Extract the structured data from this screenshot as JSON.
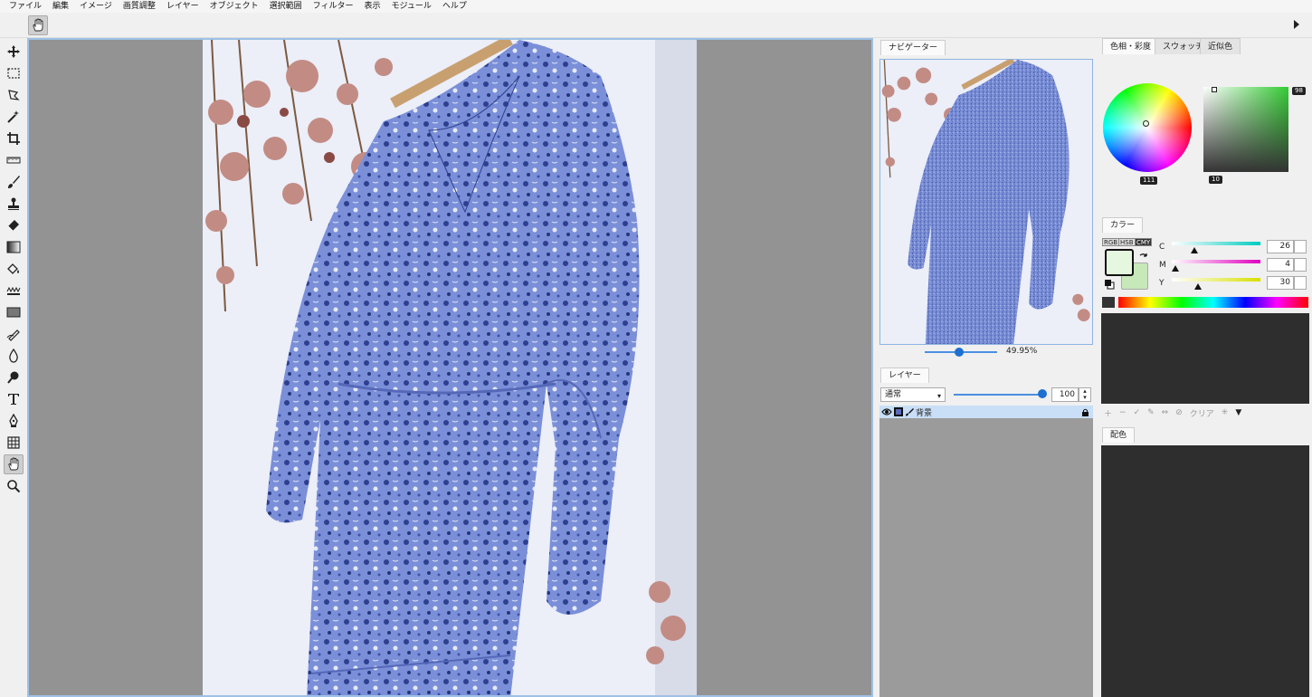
{
  "menu": [
    "ファイル",
    "編集",
    "イメージ",
    "画質調整",
    "レイヤー",
    "オブジェクト",
    "選択範囲",
    "フィルター",
    "表示",
    "モジュール",
    "ヘルプ"
  ],
  "navigator": {
    "tab": "ナビゲーター",
    "zoom": "49.95%"
  },
  "layers": {
    "tab": "レイヤー",
    "blend_mode": "通常",
    "opacity": "100",
    "rows": [
      {
        "name": "背景"
      }
    ]
  },
  "color_tabs": [
    "色相・彩度",
    "スウォッチ",
    "近似色"
  ],
  "hue": {
    "wheel_value": "111",
    "sv_top": "98",
    "sv_bottom": "10"
  },
  "color_panel": {
    "tab": "カラー",
    "modes": [
      "RGB",
      "HSB",
      "CMY"
    ],
    "channels": [
      {
        "label": "C",
        "value": "26",
        "pos": 0.26,
        "color_from": "#ffffff",
        "color_to": "#00ccc0"
      },
      {
        "label": "M",
        "value": "4",
        "pos": 0.04,
        "color_from": "#ffffff",
        "color_to": "#e000c0"
      },
      {
        "label": "Y",
        "value": "30",
        "pos": 0.3,
        "color_from": "#ffffff",
        "color_to": "#d8e000"
      }
    ],
    "fg_color": "#e6f7e0",
    "bg_color": "#c7e8b8"
  },
  "swatch_tools": {
    "clear_label": "クリア"
  },
  "haishoku": {
    "tab": "配色"
  }
}
